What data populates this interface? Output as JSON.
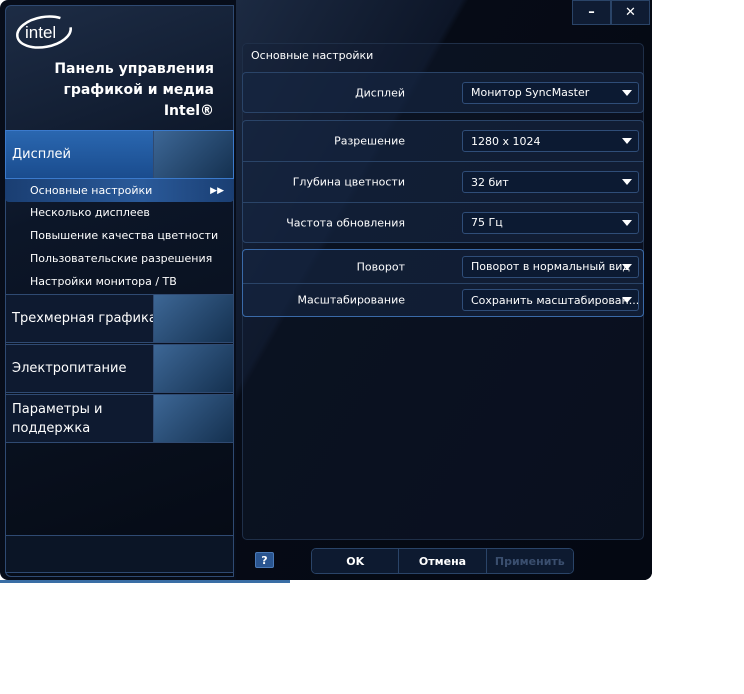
{
  "app": {
    "logo": "intel",
    "title_lines": [
      "Панель управления",
      "графикой и медиа",
      "Intel®"
    ]
  },
  "window_controls": {
    "minimize": "–",
    "close": "✕"
  },
  "sidebar": {
    "display": {
      "label": "Дисплей",
      "subitems": [
        {
          "label": "Основные настройки",
          "selected": true
        },
        {
          "label": "Несколько дисплеев"
        },
        {
          "label": "Повышение качества цветности"
        },
        {
          "label": "Пользовательские разрешения"
        },
        {
          "label": "Настройки монитора / ТВ"
        }
      ]
    },
    "categories": [
      {
        "label": "Трехмерная графика"
      },
      {
        "label": "Электропитание"
      },
      {
        "label": "Параметры и поддержка"
      }
    ],
    "selected_arrow": "▶▶"
  },
  "main": {
    "title": "Основные настройки",
    "display": {
      "label": "Дисплей",
      "value": "Монитор SyncMaster"
    },
    "resolution": {
      "label": "Разрешение",
      "value": "1280 x 1024"
    },
    "color_depth": {
      "label": "Глубина цветности",
      "value": "32 бит"
    },
    "refresh": {
      "label": "Частота обновления",
      "value": "75 Гц"
    },
    "rotation": {
      "label": "Поворот",
      "value": "Поворот в нормальный вид"
    },
    "scaling": {
      "label": "Масштабирование",
      "value": "Сохранить масштабирован..."
    }
  },
  "footer": {
    "help": "?",
    "ok": "OK",
    "cancel": "Отмена",
    "apply": "Применить"
  }
}
